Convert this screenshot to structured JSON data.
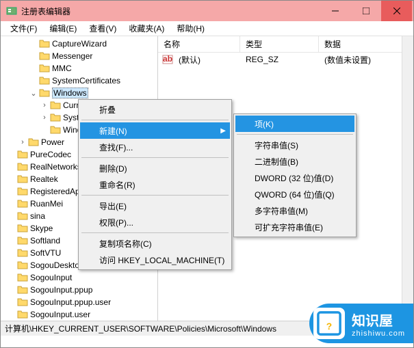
{
  "window": {
    "title": "注册表编辑器"
  },
  "menubar": [
    "文件(F)",
    "编辑(E)",
    "查看(V)",
    "收藏夹(A)",
    "帮助(H)"
  ],
  "tree": [
    {
      "level": 2,
      "exp": "",
      "label": "CaptureWizard"
    },
    {
      "level": 2,
      "exp": "",
      "label": "Messenger"
    },
    {
      "level": 2,
      "exp": "",
      "label": "MMC"
    },
    {
      "level": 2,
      "exp": "",
      "label": "SystemCertificates"
    },
    {
      "level": 2,
      "exp": "v",
      "label": "Windows",
      "selected": true
    },
    {
      "level": 3,
      "exp": ">",
      "label": "Curre"
    },
    {
      "level": 3,
      "exp": ">",
      "label": "Syster"
    },
    {
      "level": 3,
      "exp": "",
      "label": "Windows"
    },
    {
      "level": 1,
      "exp": ">",
      "label": "Power"
    },
    {
      "level": 0,
      "exp": "",
      "label": "PureCodec"
    },
    {
      "level": 0,
      "exp": "",
      "label": "RealNetworks"
    },
    {
      "level": 0,
      "exp": "",
      "label": "Realtek"
    },
    {
      "level": 0,
      "exp": "",
      "label": "RegisteredAppl"
    },
    {
      "level": 0,
      "exp": "",
      "label": "RuanMei"
    },
    {
      "level": 0,
      "exp": "",
      "label": "sina"
    },
    {
      "level": 0,
      "exp": "",
      "label": "Skype"
    },
    {
      "level": 0,
      "exp": "",
      "label": "Softland"
    },
    {
      "level": 0,
      "exp": "",
      "label": "SoftVTU"
    },
    {
      "level": 0,
      "exp": "",
      "label": "SogouDesktopBar"
    },
    {
      "level": 0,
      "exp": "",
      "label": "SogouInput"
    },
    {
      "level": 0,
      "exp": "",
      "label": "SogouInput.ppup"
    },
    {
      "level": 0,
      "exp": "",
      "label": "SogouInput.ppup.user"
    },
    {
      "level": 0,
      "exp": "",
      "label": "SogouInput.user"
    }
  ],
  "list": {
    "columns": {
      "name": "名称",
      "type": "类型",
      "data": "数据"
    },
    "rows": [
      {
        "name": "(默认)",
        "type": "REG_SZ",
        "data": "(数值未设置)"
      }
    ]
  },
  "contextMenu": {
    "items": [
      {
        "label": "折叠"
      },
      {
        "sep": true
      },
      {
        "label": "新建(N)",
        "submenu": true,
        "highlighted": true
      },
      {
        "label": "查找(F)..."
      },
      {
        "sep": true
      },
      {
        "label": "删除(D)"
      },
      {
        "label": "重命名(R)"
      },
      {
        "sep": true
      },
      {
        "label": "导出(E)"
      },
      {
        "label": "权限(P)..."
      },
      {
        "sep": true
      },
      {
        "label": "复制项名称(C)"
      },
      {
        "label": "访问 HKEY_LOCAL_MACHINE(T)"
      }
    ],
    "submenu": [
      {
        "label": "项(K)",
        "highlighted": true
      },
      {
        "sep": true
      },
      {
        "label": "字符串值(S)"
      },
      {
        "label": "二进制值(B)"
      },
      {
        "label": "DWORD (32 位)值(D)"
      },
      {
        "label": "QWORD (64 位)值(Q)"
      },
      {
        "label": "多字符串值(M)"
      },
      {
        "label": "可扩充字符串值(E)"
      }
    ]
  },
  "statusbar": "计算机\\HKEY_CURRENT_USER\\SOFTWARE\\Policies\\Microsoft\\Windows",
  "logo": {
    "name": "知识屋",
    "url": "zhishiwu.com",
    "mark": "?"
  }
}
